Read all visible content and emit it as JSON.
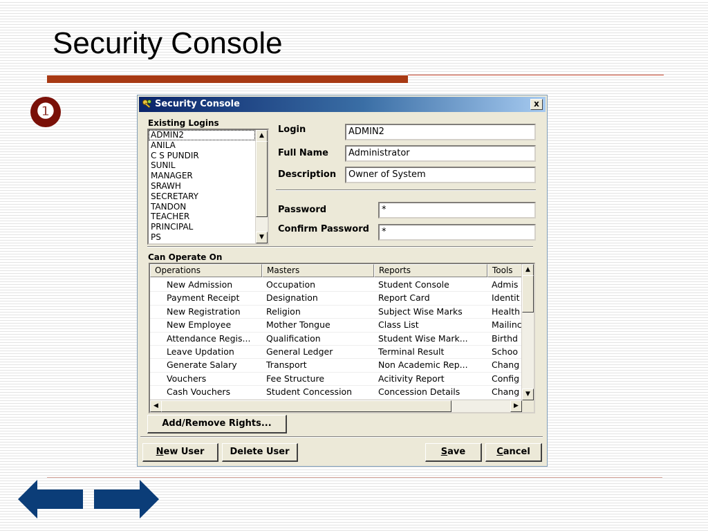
{
  "slide": {
    "title": "Security Console",
    "bullet": "❶"
  },
  "window": {
    "title": "Security Console",
    "close_glyph": "x",
    "icon": "keys-icon"
  },
  "existing_logins": {
    "label": "Existing Logins",
    "items": [
      "ADMIN2",
      "ANILA",
      "C S PUNDIR",
      "SUNIL",
      "MANAGER",
      "SRAWH",
      "SECRETARY",
      "TANDON",
      "TEACHER",
      "PRINCIPAL",
      "PS"
    ],
    "selected": "ADMIN2"
  },
  "form": {
    "login_label": "Login",
    "login_value": "ADMIN2",
    "fullname_label": "Full Name",
    "fullname_value": "Administrator",
    "description_label": "Description",
    "description_value": "Owner of System",
    "password_label": "Password",
    "password_value": "*",
    "confirm_label": "Confirm Password",
    "confirm_value": "*"
  },
  "can_operate_on": {
    "label": "Can Operate On",
    "columns": [
      "Operations",
      "Masters",
      "Reports",
      "Tools"
    ],
    "rows": [
      [
        "New Admission",
        "Occupation",
        "Student Console",
        "Admis"
      ],
      [
        "Payment Receipt",
        "Designation",
        "Report Card",
        "Identit"
      ],
      [
        "New Registration",
        "Religion",
        "Subject Wise Marks",
        "Health"
      ],
      [
        "New Employee",
        "Mother Tongue",
        "Class List",
        "Mailinc"
      ],
      [
        "Attendance Regis...",
        "Qualification",
        "Student Wise Mark...",
        "Birthd"
      ],
      [
        "Leave Updation",
        "General Ledger",
        "Terminal Result",
        "Schoo"
      ],
      [
        "Generate Salary",
        "Transport",
        "Non Academic Rep...",
        "Chang"
      ],
      [
        "Vouchers",
        "Fee Structure",
        "Acitivity Report",
        "Config"
      ],
      [
        "Cash Vouchers",
        "Student Concession",
        "Concession Details",
        "Chang"
      ]
    ]
  },
  "buttons": {
    "add_remove": "Add/Remove Rights...",
    "new_user": "New User",
    "delete_user": "Delete User",
    "save": "Save",
    "cancel": "Cancel"
  },
  "nav": {
    "back_icon": "arrow-left-icon",
    "forward_icon": "arrow-right-icon",
    "color": "#0b3d78"
  }
}
